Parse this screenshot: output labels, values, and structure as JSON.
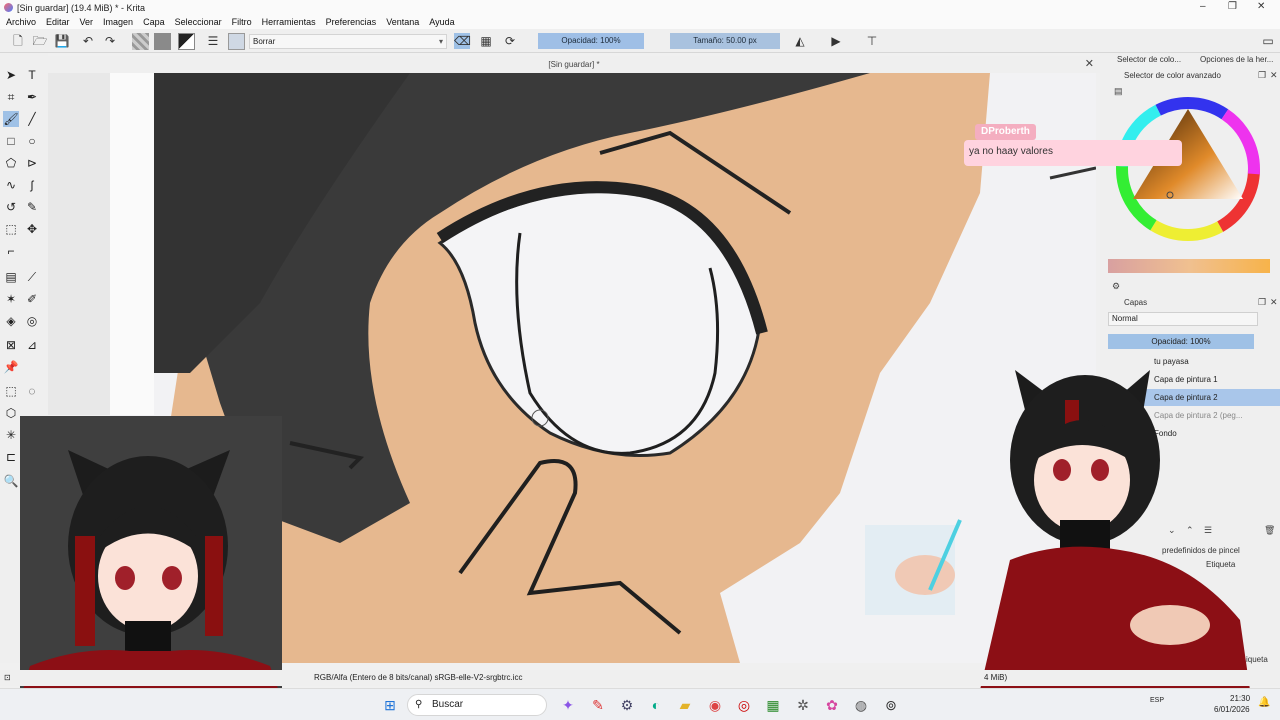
{
  "window": {
    "title": "[Sin guardar]  (19.4 MiB)  * - Krita"
  },
  "menu": [
    "Archivo",
    "Editar",
    "Ver",
    "Imagen",
    "Capa",
    "Seleccionar",
    "Filtro",
    "Herramientas",
    "Preferencias",
    "Ventana",
    "Ayuda"
  ],
  "toolbar": {
    "preset": "Borrar",
    "opacity": "Opacidad: 100%",
    "size": "Tamaño: 50.00 px"
  },
  "document": {
    "tab_title": "[Sin guardar]  *"
  },
  "right_panel": {
    "tab_color": "Selector de colo...",
    "tab_options": "Opciones de la her...",
    "advanced_selector": "Selector de color avanzado",
    "layers_title": "Capas",
    "blend_mode": "Normal",
    "layer_opacity": "Opacidad: 100%",
    "layers": [
      {
        "name": "tu payasa",
        "selected": false
      },
      {
        "name": "Capa de pintura 1",
        "selected": false
      },
      {
        "name": "Capa de pintura 2",
        "selected": true
      },
      {
        "name": "Capa de pintura 2 (peg...",
        "selected": false
      },
      {
        "name": "Fondo",
        "selected": false
      }
    ],
    "brush_presets": "predefinidos de pincel",
    "tag_label": "Etiqueta",
    "tag_label2": "iqueta"
  },
  "chat": {
    "user": "DProberth",
    "message": "ya no haay valores"
  },
  "status": {
    "color_space": "RGB/Alfa (Entero de 8 bits/canal)  sRGB-elle-V2-srgbtrc.icc",
    "memory": "4 MiB)"
  },
  "taskbar": {
    "search": "Buscar",
    "time": "21:30",
    "date": "6/01/2026",
    "lang": "ESP"
  },
  "colors": {
    "accent": "#9fc1e6",
    "skin": "#e6b88f",
    "hair": "#3a3a3a"
  }
}
